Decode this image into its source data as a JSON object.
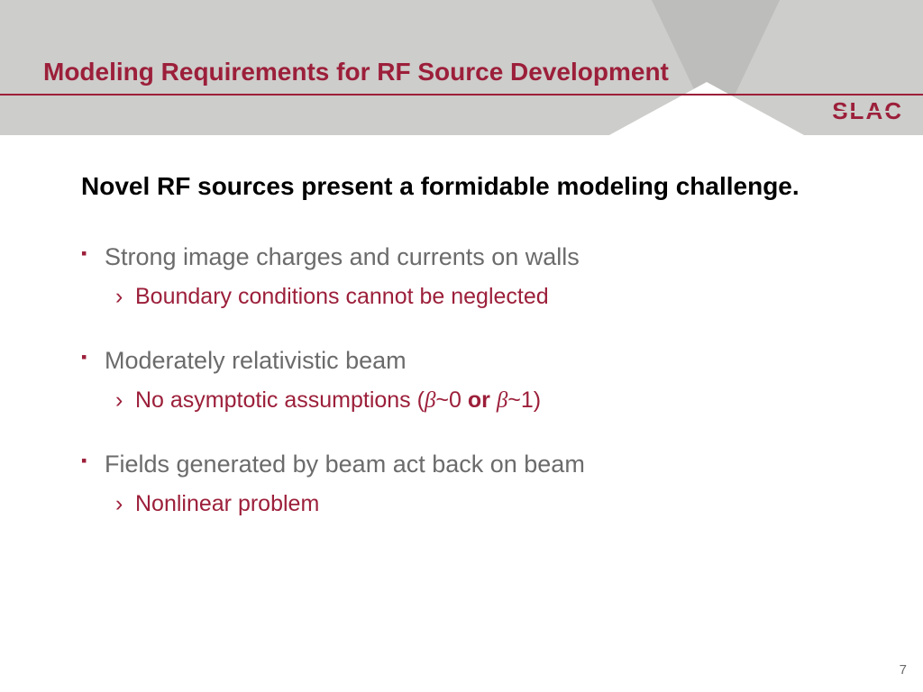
{
  "header": {
    "title": "Modeling Requirements for RF Source Development",
    "logo": "SLAC"
  },
  "lead": "Novel RF sources present a formidable modeling challenge.",
  "bullets": [
    {
      "text": "Strong image charges and currents on walls",
      "sub": [
        {
          "text": "Boundary conditions cannot be neglected"
        }
      ]
    },
    {
      "text": "Moderately relativistic beam",
      "sub": [
        {
          "prefix": "No asymptotic assumptions (",
          "beta1": "β",
          "rel1": "~0",
          "or": " or ",
          "beta2": "β",
          "rel2": "~1)"
        }
      ]
    },
    {
      "text": "Fields generated by beam act back on beam",
      "sub": [
        {
          "text": "Nonlinear problem"
        }
      ]
    }
  ],
  "page_number": "7"
}
